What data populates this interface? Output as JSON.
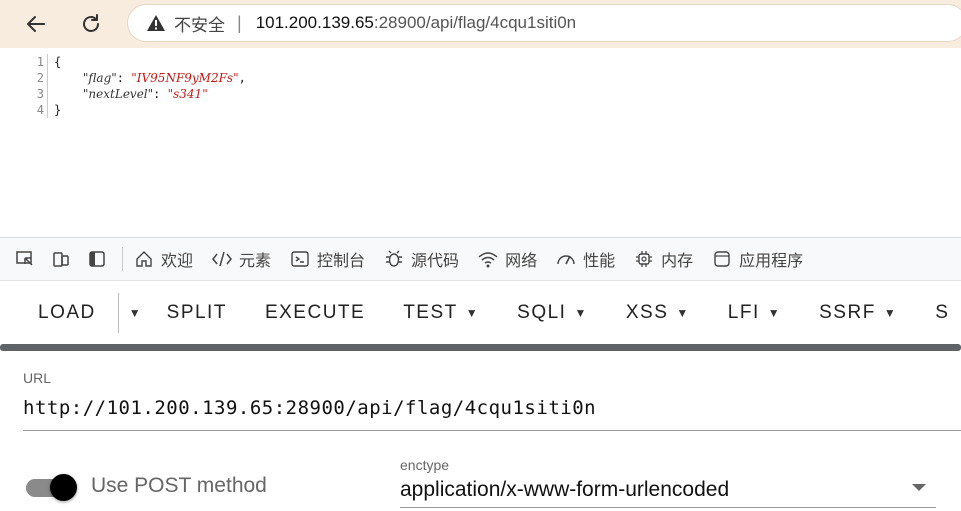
{
  "browser": {
    "security_label": "不安全",
    "url_host": "101.200.139.65",
    "url_rest": ":28900/api/flag/4cqu1siti0n"
  },
  "json_viewer": {
    "line_numbers": [
      "1",
      "2",
      "3",
      "4"
    ],
    "open_brace": "{",
    "close_brace": "}",
    "entries": [
      {
        "key": "\"flag\"",
        "value": "\"IV95NF9yM2Fs\"",
        "comma": ","
      },
      {
        "key": "\"nextLevel\"",
        "value": "\"s341\"",
        "comma": ""
      }
    ]
  },
  "devtools": {
    "tabs": [
      {
        "label": "欢迎",
        "icon": "home-icon"
      },
      {
        "label": "元素",
        "icon": "code-icon"
      },
      {
        "label": "控制台",
        "icon": "console-icon"
      },
      {
        "label": "源代码",
        "icon": "bug-icon"
      },
      {
        "label": "网络",
        "icon": "wifi-icon"
      },
      {
        "label": "性能",
        "icon": "gauge-icon"
      },
      {
        "label": "内存",
        "icon": "chip-icon"
      },
      {
        "label": "应用程序",
        "icon": "app-icon"
      }
    ]
  },
  "hackbar": {
    "load": "LOAD",
    "split": "SPLIT",
    "execute": "EXECUTE",
    "test": "TEST",
    "sqli": "SQLI",
    "xss": "XSS",
    "lfi": "LFI",
    "ssrf": "SSRF",
    "next_partial": "S",
    "url_label": "URL",
    "url_value": "http://101.200.139.65:28900/api/flag/4cqu1siti0n",
    "post_label": "Use POST method",
    "post_enabled": true,
    "enctype_label": "enctype",
    "enctype_value": "application/x-www-form-urlencoded"
  },
  "colors": {
    "topbar_bg": "#f7ecdd",
    "json_string": "#c41a16",
    "progress_bar": "#5f6368"
  }
}
